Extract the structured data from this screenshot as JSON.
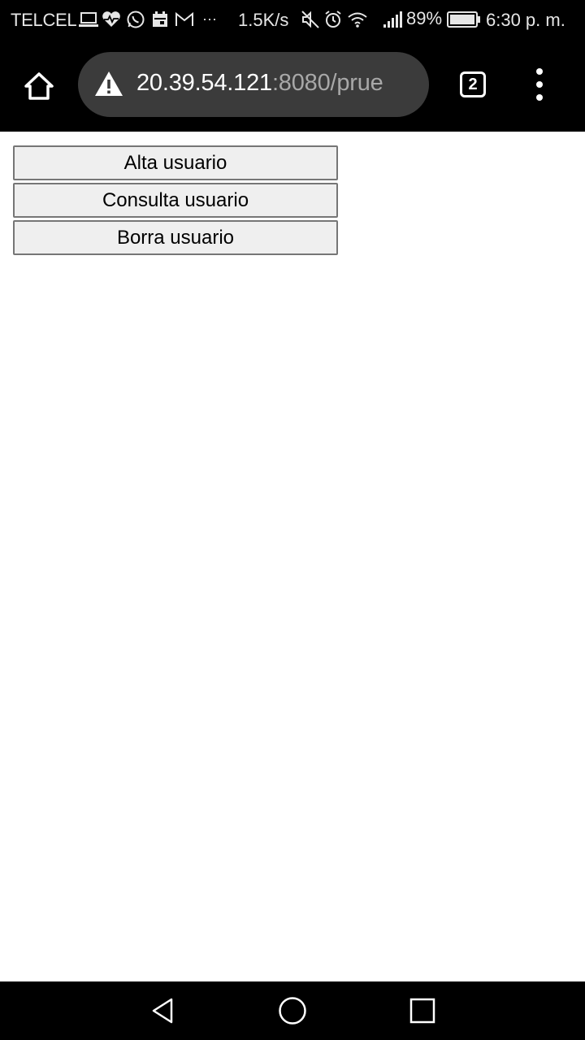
{
  "status_bar": {
    "carrier": "TELCEL",
    "notification_icons": [
      "laptop-icon",
      "heart-rate-icon",
      "whatsapp-icon",
      "calendar-icon",
      "gmail-icon",
      "more-dots-icon"
    ],
    "more_dots": "···",
    "net_speed": "1.5K/s",
    "system_icons": [
      "mute-icon",
      "alarm-icon",
      "wifi-icon",
      "signal-icon"
    ],
    "battery_percent": "89%",
    "time": "6:30 p. m."
  },
  "browser": {
    "url_host": "20.39.54.121",
    "url_rest": ":8080/prue",
    "security_icon": "warning-icon",
    "tab_count": "2",
    "colors": {
      "toolbar_bg": "#000000",
      "url_bar_bg": "#3b3b3b",
      "url_host": "#ffffff",
      "url_rest": "#a8a8a8"
    }
  },
  "page": {
    "buttons": [
      {
        "label": "Alta usuario"
      },
      {
        "label": "Consulta usuario"
      },
      {
        "label": "Borra usuario"
      }
    ],
    "colors": {
      "button_bg": "#efefef",
      "button_border": "#767676"
    }
  },
  "nav_bar": {
    "buttons": [
      "back-icon",
      "home-icon",
      "recents-icon"
    ]
  }
}
